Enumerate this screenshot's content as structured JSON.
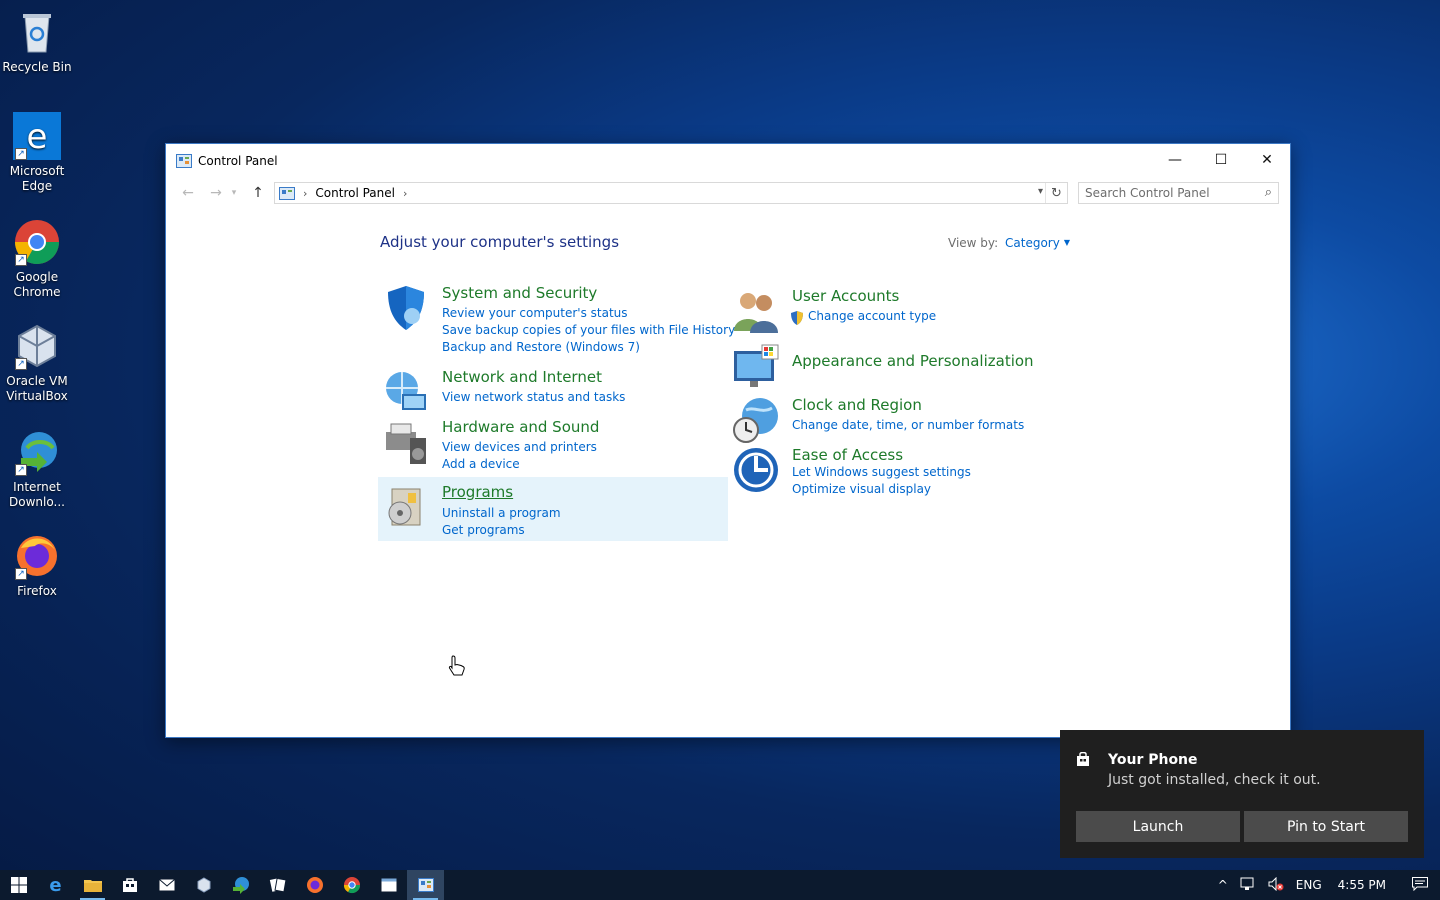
{
  "desktop": {
    "icons": [
      {
        "label": "Recycle Bin",
        "icon": "recycle-bin-icon"
      },
      {
        "label": "Microsoft Edge",
        "icon": "edge-icon"
      },
      {
        "label": "Google Chrome",
        "icon": "chrome-icon"
      },
      {
        "label": "Oracle VM VirtualBox",
        "icon": "virtualbox-icon"
      },
      {
        "label": "Internet Downlo...",
        "icon": "internet-download-manager-icon"
      },
      {
        "label": "Firefox",
        "icon": "firefox-icon"
      }
    ]
  },
  "window": {
    "title": "Control Panel",
    "controls": {
      "minimize": "—",
      "maximize": "☐",
      "close": "✕"
    }
  },
  "address": {
    "crumb": "Control Panel",
    "search_placeholder": "Search Control Panel"
  },
  "content": {
    "heading": "Adjust your computer's settings",
    "view_by_label": "View by:",
    "view_by_value": "Category",
    "categories_left": [
      {
        "title": "System and Security",
        "links": [
          "Review your computer's status",
          "Save backup copies of your files with File History",
          "Backup and Restore (Windows 7)"
        ]
      },
      {
        "title": "Network and Internet",
        "links": [
          "View network status and tasks"
        ]
      },
      {
        "title": "Hardware and Sound",
        "links": [
          "View devices and printers",
          "Add a device"
        ]
      },
      {
        "title": "Programs",
        "links": [
          "Uninstall a program",
          "Get programs"
        ]
      }
    ],
    "categories_right": [
      {
        "title": "User Accounts",
        "links": [
          "Change account type"
        ]
      },
      {
        "title": "Appearance and Personalization",
        "links": []
      },
      {
        "title": "Clock and Region",
        "links": [
          "Change date, time, or number formats"
        ]
      },
      {
        "title": "Ease of Access",
        "links": [
          "Let Windows suggest settings",
          "Optimize visual display"
        ]
      }
    ]
  },
  "toast": {
    "title": "Your Phone",
    "body": "Just got installed, check it out.",
    "launch_label": "Launch",
    "pin_label": "Pin to Start"
  },
  "taskbar": {
    "language": "ENG",
    "time": "4:55 PM"
  },
  "colors": {
    "category_title": "#1e7a2a",
    "link": "#0066cc",
    "heading": "#1e3287",
    "hover_bg": "#e5f3fb"
  }
}
